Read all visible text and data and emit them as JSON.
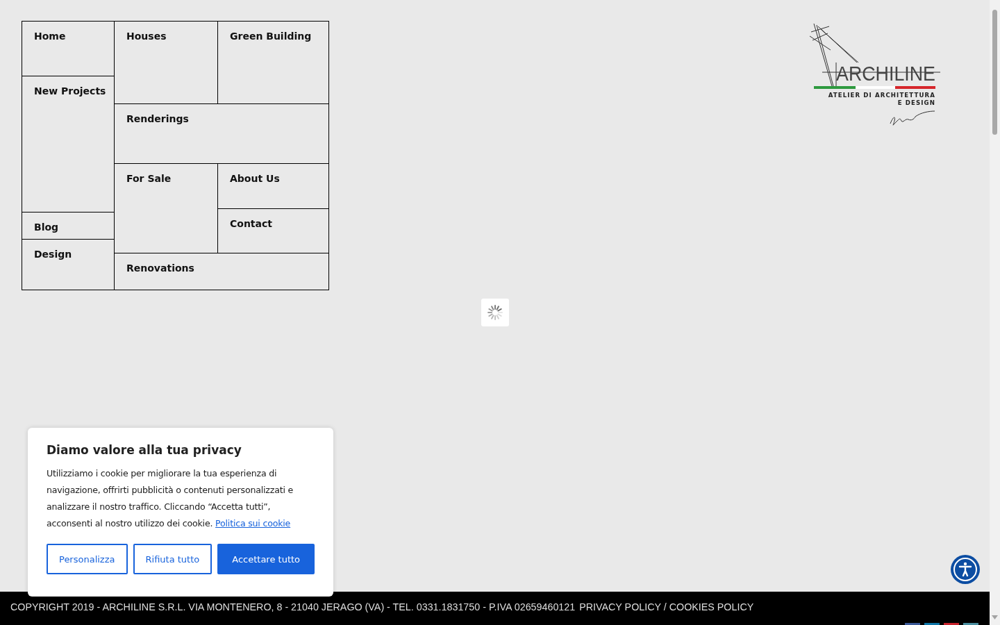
{
  "menu": [
    {
      "label": "Home"
    },
    {
      "label": "Houses"
    },
    {
      "label": "Green Building"
    },
    {
      "label": "New Projects"
    },
    {
      "label": "Renderings"
    },
    {
      "label": "For Sale"
    },
    {
      "label": "About Us"
    },
    {
      "label": "Contact"
    },
    {
      "label": "Blog"
    },
    {
      "label": "Design"
    },
    {
      "label": "Renovations"
    }
  ],
  "logo": {
    "name": "ARCHILINE",
    "tagline_1": "ATELIER DI ARCHITETTURA",
    "tagline_2": "E DESIGN"
  },
  "cookie_banner": {
    "title": "Diamo valore alla tua privacy",
    "text": "Utilizziamo i cookie per migliorare la tua esperienza di navigazione, offrirti pubblicità o contenuti personalizzati e analizzare il nostro traffico. Cliccando “Accetta tutti”, acconsenti al nostro utilizzo dei cookie.",
    "link": "Politica sui cookie",
    "buttons": [
      {
        "label": "Personalizza",
        "kind": "outline"
      },
      {
        "label": "Rifiuta tutto",
        "kind": "outline"
      },
      {
        "label": "Accettare tutto",
        "kind": "primary"
      }
    ]
  },
  "footer": {
    "copyright": "COPYRIGHT 2019 - ARCHILINE S.R.L. VIA MONTENERO, 8 - 21040 JERAGO (VA) - TEL. 0331.1831750 - P.IVA 02659460121",
    "link": "PRIVACY POLICY / COOKIES POLICY"
  }
}
